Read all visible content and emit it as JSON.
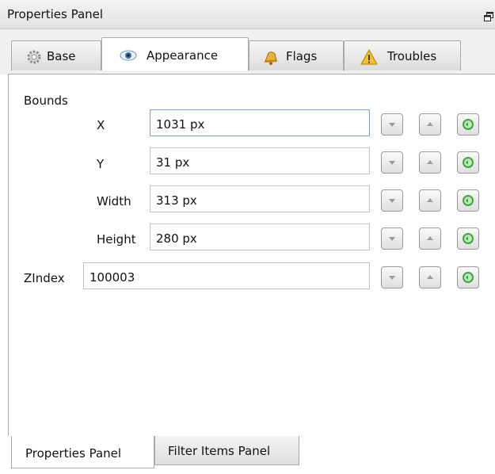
{
  "window": {
    "title": "Properties Panel",
    "float_icon": "restore-window-icon"
  },
  "tabs": [
    {
      "label": "Base",
      "icon": "gear-icon"
    },
    {
      "label": "Appearance",
      "icon": "eye-icon"
    },
    {
      "label": "Flags",
      "icon": "bell-icon"
    },
    {
      "label": "Troubles",
      "icon": "warning-icon"
    }
  ],
  "active_tab": "Appearance",
  "bounds": {
    "label": "Bounds",
    "x": {
      "label": "X",
      "value": "1031 px"
    },
    "y": {
      "label": "Y",
      "value": "31 px"
    },
    "width": {
      "label": "Width",
      "value": "313 px"
    },
    "height": {
      "label": "Height",
      "value": "280 px"
    }
  },
  "zindex": {
    "label": "ZIndex",
    "value": "100003"
  },
  "row_buttons": [
    "decrement-icon",
    "increment-icon",
    "reset-icon"
  ],
  "bottom_tabs": [
    {
      "label": "Properties Panel"
    },
    {
      "label": "Filter Items Panel"
    }
  ],
  "colors": {
    "reset_green": "#3fa33f",
    "focus_border": "#7aa3cc",
    "warning_yellow": "#f2c12e"
  }
}
